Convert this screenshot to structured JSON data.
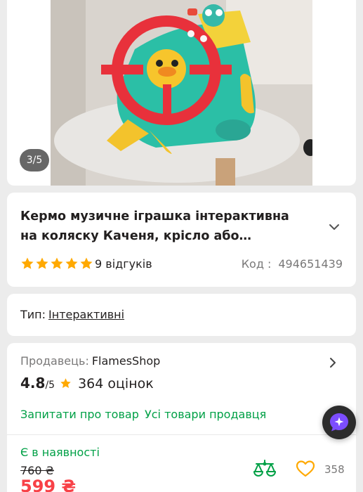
{
  "gallery": {
    "counter": "3/5",
    "image_alt": "Кермо музичне іграшка інтерактивна"
  },
  "product": {
    "title": "Кермо музичне іграшка інтерактивна на коляску Каченя, крісло або кроватку з...",
    "rating_stars": 5,
    "reviews": "9 відгуків",
    "code_label": "Код :",
    "code_value": "494651439"
  },
  "type": {
    "label": "Тип:",
    "value": "Інтерактивні"
  },
  "seller": {
    "label": "Продавець:",
    "name": "FlamesShop",
    "rating": "4.8",
    "rating_of": "/5",
    "rating_count": "364 оцінок",
    "ask_link": "Запитати про товар",
    "all_goods_link": "Усі товари продавця"
  },
  "offer": {
    "availability": "Є в наявності",
    "old_price": "760 ₴",
    "price": "599 ₴",
    "favorites_count": "358"
  },
  "colors": {
    "accent_green": "#00a046",
    "price_red": "#f84147",
    "star_yellow": "#ffa900",
    "assistant_purple": "#7c4dff"
  }
}
